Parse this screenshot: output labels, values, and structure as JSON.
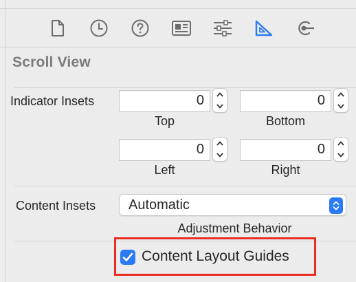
{
  "window": {
    "accent_color": "#2a7bf5",
    "highlight_color": "#ea2c22"
  },
  "tabs": [
    {
      "icon": "file-icon",
      "selected": false
    },
    {
      "icon": "history-icon",
      "selected": false
    },
    {
      "icon": "help-icon",
      "selected": false
    },
    {
      "icon": "identity-card-icon",
      "selected": false
    },
    {
      "icon": "sliders-icon",
      "selected": false
    },
    {
      "icon": "ruler-triangle-icon",
      "selected": true
    },
    {
      "icon": "connections-icon",
      "selected": false
    }
  ],
  "scroll_view": {
    "section_title": "Scroll View",
    "indicator_insets": {
      "label": "Indicator Insets",
      "top": {
        "value": "0",
        "caption": "Top"
      },
      "bottom": {
        "value": "0",
        "caption": "Bottom"
      },
      "left": {
        "value": "0",
        "caption": "Left"
      },
      "right": {
        "value": "0",
        "caption": "Right"
      }
    },
    "content_insets": {
      "label": "Content Insets",
      "selected_value": "Automatic",
      "caption": "Adjustment Behavior"
    },
    "content_layout_guides": {
      "label": "Content Layout Guides",
      "checked": true
    }
  }
}
